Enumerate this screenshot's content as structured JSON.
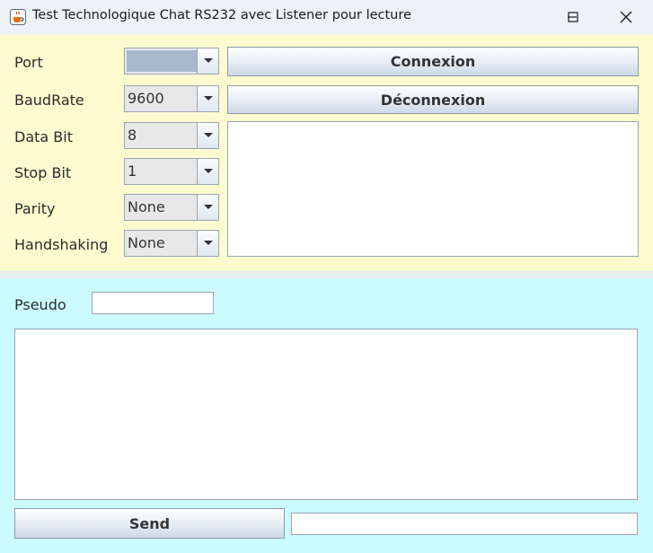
{
  "window": {
    "title": "Test Technologique Chat RS232 avec Listener pour lecture",
    "icons": {
      "app": "java-cup-icon",
      "minimize": "minimize-icon",
      "maximize": "maximize-icon",
      "close": "close-icon"
    }
  },
  "settings": {
    "port": {
      "label": "Port",
      "value": ""
    },
    "baudrate": {
      "label": "BaudRate",
      "value": "9600"
    },
    "databit": {
      "label": "Data Bit",
      "value": "8"
    },
    "stopbit": {
      "label": "Stop Bit",
      "value": "1"
    },
    "parity": {
      "label": "Parity",
      "value": "None"
    },
    "handshaking": {
      "label": "Handshaking",
      "value": "None"
    }
  },
  "actions": {
    "connect_label": "Connexion",
    "disconnect_label": "Déconnexion"
  },
  "status_area": {
    "text": ""
  },
  "chat": {
    "pseudo_label": "Pseudo",
    "pseudo_value": "",
    "messages_text": "",
    "send_label": "Send",
    "message_value": ""
  },
  "colors": {
    "top_panel": "#fefbd1",
    "bottom_panel": "#cbfbfc",
    "combo_port_selection": "#a8b8cc"
  }
}
